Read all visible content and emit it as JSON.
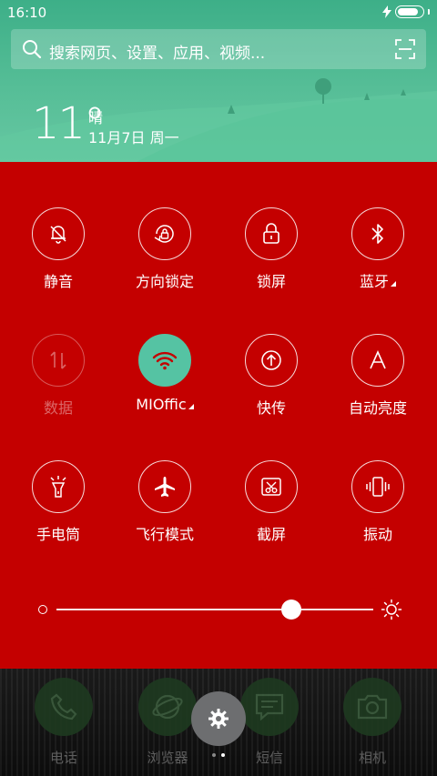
{
  "status_bar": {
    "time": "16:10",
    "charging_icon": "lightning-icon",
    "battery_icon": "battery-icon"
  },
  "search": {
    "placeholder": "搜索网页、设置、应用、视频..."
  },
  "weather": {
    "temperature": "11°",
    "condition": "晴",
    "date": "11月7日 周一"
  },
  "toggles": [
    {
      "label": "静音",
      "icon": "bell-off-icon",
      "state": "off"
    },
    {
      "label": "方向锁定",
      "icon": "rotation-lock-icon",
      "state": "off"
    },
    {
      "label": "锁屏",
      "icon": "lock-icon",
      "state": "off"
    },
    {
      "label": "蓝牙",
      "icon": "bluetooth-icon",
      "state": "off",
      "has_more": true
    },
    {
      "label": "数据",
      "icon": "mobile-data-icon",
      "state": "disabled"
    },
    {
      "label": "MIOffic",
      "icon": "wifi-icon",
      "state": "on",
      "has_more": true
    },
    {
      "label": "快传",
      "icon": "share-upload-icon",
      "state": "off"
    },
    {
      "label": "自动亮度",
      "icon": "auto-brightness-icon",
      "state": "off"
    },
    {
      "label": "手电筒",
      "icon": "flashlight-icon",
      "state": "off"
    },
    {
      "label": "飞行模式",
      "icon": "airplane-icon",
      "state": "off"
    },
    {
      "label": "截屏",
      "icon": "screenshot-icon",
      "state": "off"
    },
    {
      "label": "振动",
      "icon": "vibrate-icon",
      "state": "off"
    }
  ],
  "brightness": {
    "level": 0.74
  },
  "dock": [
    {
      "label": "电话",
      "icon": "phone-icon"
    },
    {
      "label": "浏览器",
      "icon": "browser-icon"
    },
    {
      "label": "短信",
      "icon": "message-icon"
    },
    {
      "label": "相机",
      "icon": "camera-icon"
    }
  ],
  "colors": {
    "panel": "#c40000",
    "accent": "#55c3a3",
    "header": "#56be97"
  }
}
